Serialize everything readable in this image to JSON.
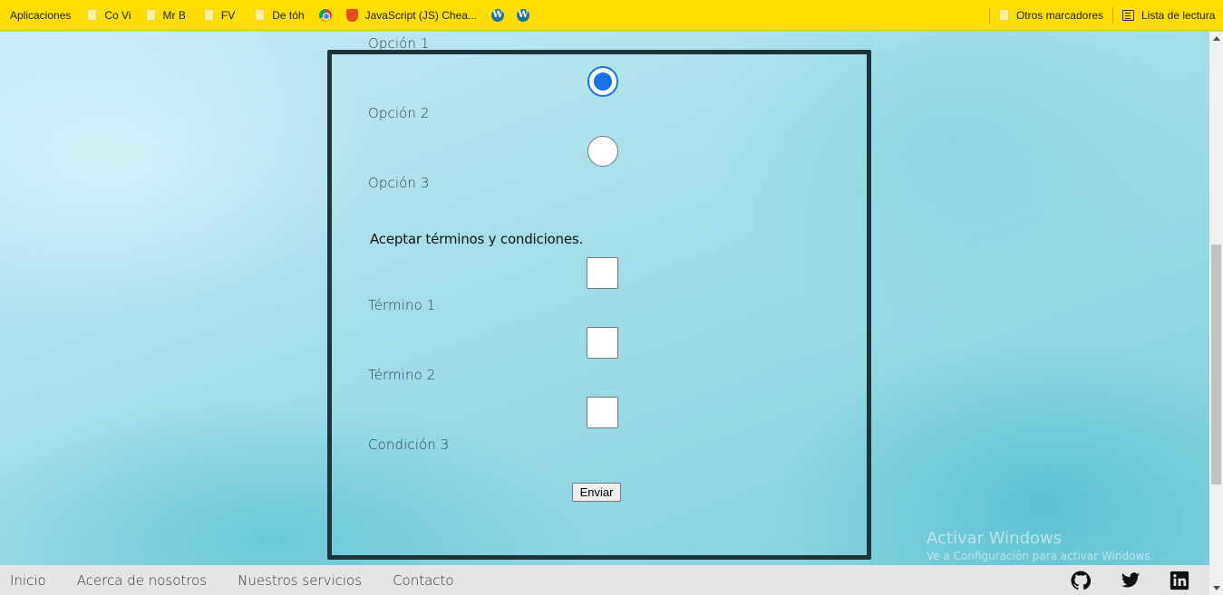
{
  "bookmarks": {
    "items": [
      {
        "label": "Aplicaciones",
        "icon": "apps-icon"
      },
      {
        "label": "Co Vi",
        "icon": "folder-icon"
      },
      {
        "label": "Mr B",
        "icon": "folder-icon"
      },
      {
        "label": "FV",
        "icon": "folder-icon"
      },
      {
        "label": "De tóh",
        "icon": "folder-icon"
      },
      {
        "label": "",
        "icon": "chrome-icon"
      },
      {
        "label": "JavaScript (JS) Chea...",
        "icon": "javascript-icon"
      },
      {
        "label": "",
        "icon": "wordpress-icon"
      },
      {
        "label": "",
        "icon": "wordpress-icon"
      }
    ],
    "other": "Otros marcadores",
    "reading_list": "Lista de lectura"
  },
  "form": {
    "radio_options": [
      {
        "label": "Opción 1",
        "checked": true
      },
      {
        "label": "Opción 2",
        "checked": false
      },
      {
        "label": "Opción 3"
      }
    ],
    "terms_heading": "Aceptar términos y condiciones.",
    "terms": [
      {
        "label": "Término 1",
        "checked": false
      },
      {
        "label": "Término 2",
        "checked": false
      },
      {
        "label": "Condición 3",
        "checked": false
      }
    ],
    "submit_label": "Enviar"
  },
  "watermark": {
    "title": "Activar Windows",
    "subtitle": "Ve a Configuración para activar Windows."
  },
  "footer": {
    "nav": [
      "Inicio",
      "Acerca de nosotros",
      "Nuestros servicios",
      "Contacto"
    ],
    "social": [
      "github-icon",
      "twitter-icon",
      "linkedin-icon"
    ]
  },
  "colors": {
    "bookmarks_bar": "#ffde00",
    "panel_border": "#1f3436",
    "radio_accent": "#1a73e8",
    "footer_bg": "#e5e5e5"
  }
}
